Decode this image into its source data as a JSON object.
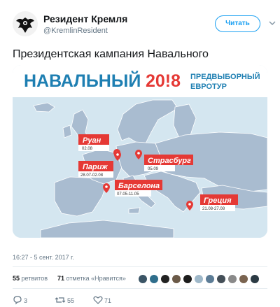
{
  "tweet": {
    "display_name": "Резидент Кремля",
    "handle": "@KremlinResident",
    "follow_label": "Читать",
    "text": "Президентская кампания Навального",
    "timestamp": "16:27 - 5 сент. 2017 г."
  },
  "media": {
    "banner_name": "НАВАЛЬНЫЙ",
    "banner_year": "20!8",
    "banner_line1": "ПРЕДВЫБОРНЫЙ",
    "banner_line2": "ЕВРОТУР",
    "stops": [
      {
        "city": "Руан",
        "date": "02.08"
      },
      {
        "city": "Страсбург",
        "date": "05.09"
      },
      {
        "city": "Париж",
        "date": "28.07-02.08"
      },
      {
        "city": "Барселона",
        "date": "07.05-11.05"
      },
      {
        "city": "Греция",
        "date": "21.08-27.08"
      }
    ]
  },
  "stats": {
    "retweets_count": "55",
    "retweets_label": "ретвитов",
    "likes_count": "71",
    "likes_label": "отметка «Нравится»"
  },
  "actions": {
    "reply_count": "3",
    "retweet_count": "55",
    "like_count": "71"
  },
  "colors": {
    "accent": "#1da1f2",
    "banner_blue": "#1e7fb2",
    "banner_red": "#e53935",
    "map_land": "#a9bcd0",
    "map_sea": "#d4e6f0"
  }
}
